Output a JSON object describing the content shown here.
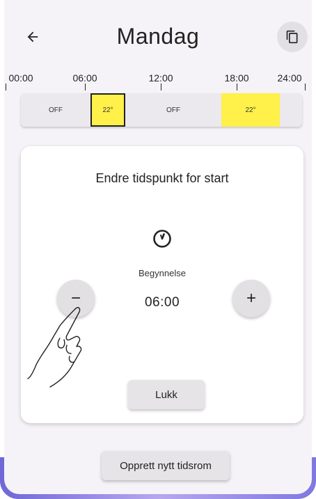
{
  "header": {
    "title": "Mandag",
    "back_icon": "arrow-left-icon",
    "copy_icon": "copy-icon"
  },
  "timeline": {
    "labels": [
      "00:00",
      "06:00",
      "12:00",
      "18:00",
      "24:00"
    ],
    "segments": [
      {
        "label": "OFF",
        "state": "off"
      },
      {
        "label": "22°",
        "state": "on",
        "selected": true
      },
      {
        "label": "OFF",
        "state": "off"
      },
      {
        "label": "22°",
        "state": "on"
      }
    ]
  },
  "card": {
    "title": "Endre tidspunkt for start",
    "clock_icon": "clock-icon",
    "field_label": "Begynnelse",
    "value": "06:00",
    "decrement_label": "−",
    "increment_label": "+",
    "close_label": "Lukk"
  },
  "footer": {
    "new_slot_label": "Opprett nytt tidsrom"
  },
  "colors": {
    "accent_yellow": "#fff04a",
    "background": "#f5f3f7",
    "bottom_accent": "#7f78e0"
  }
}
